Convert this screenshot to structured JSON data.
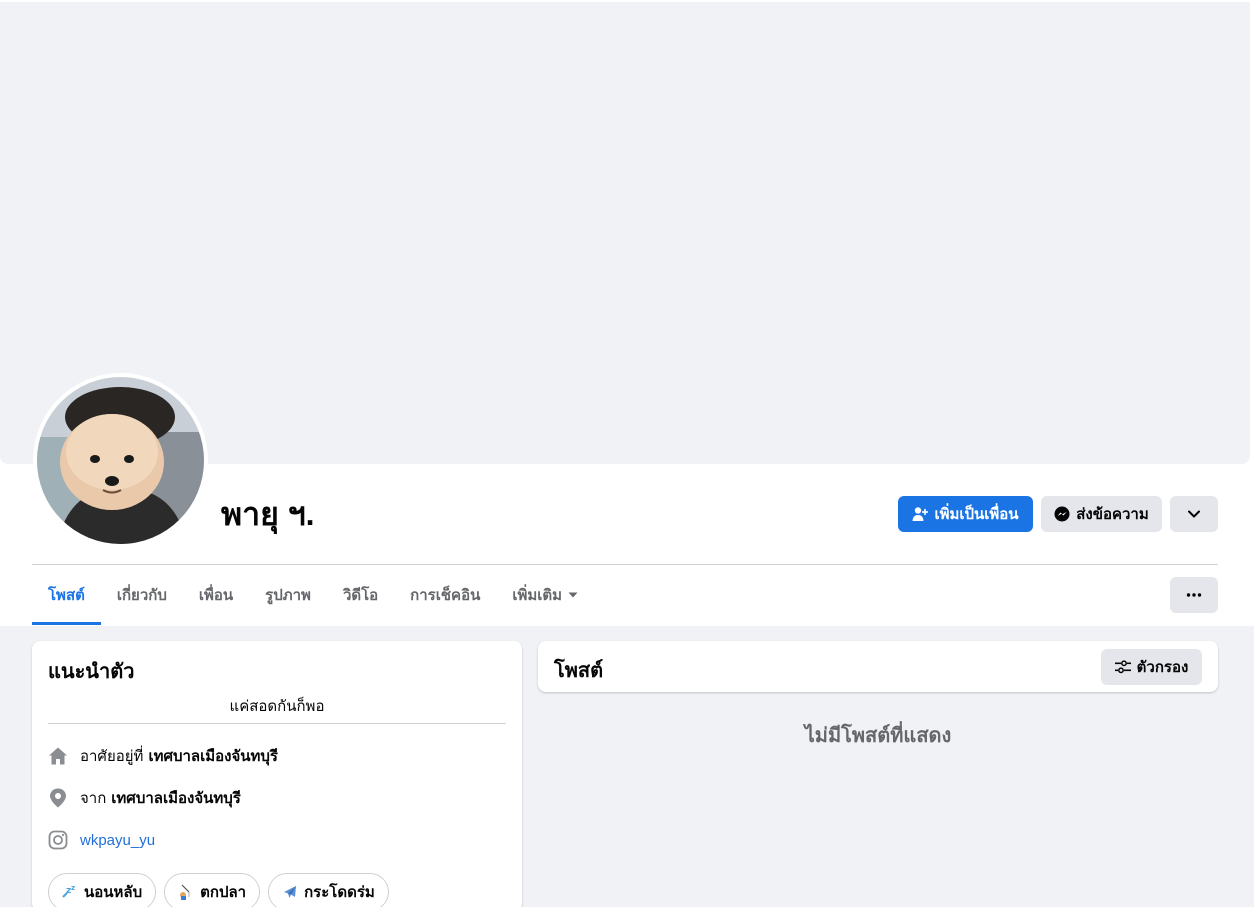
{
  "profile": {
    "name": "พายุ ฯ."
  },
  "actions": {
    "add_friend_label": "เพิ่มเป็นเพื่อน",
    "message_label": "ส่งข้อความ"
  },
  "tabs": [
    {
      "label": "โพสต์",
      "active": true
    },
    {
      "label": "เกี่ยวกับ"
    },
    {
      "label": "เพื่อน"
    },
    {
      "label": "รูปภาพ"
    },
    {
      "label": "วิดีโอ"
    },
    {
      "label": "การเช็คอิน"
    },
    {
      "label": "เพิ่มเติม"
    }
  ],
  "intro": {
    "title": "แนะนำตัว",
    "bio": "แค่สอดกันก็พอ",
    "lives_in_prefix": "อาศัยอยู่ที่",
    "lives_in_place": "เทศบาลเมืองจันทบุรี",
    "from_prefix": "จาก",
    "from_place": "เทศบาลเมืองจันทบุรี",
    "instagram": "wkpayu_yu",
    "hobbies": [
      "นอนหลับ",
      "ตกปลา",
      "กระโดดร่ม"
    ]
  },
  "posts": {
    "title": "โพสต์",
    "filter_label": "ตัวกรอง",
    "empty_text": "ไม่มีโพสต์ที่แสดง"
  },
  "colors": {
    "accent": "#1b74e4",
    "secondary_button": "#e4e6eb",
    "background": "#f0f2f5",
    "muted_text": "#65676b"
  }
}
